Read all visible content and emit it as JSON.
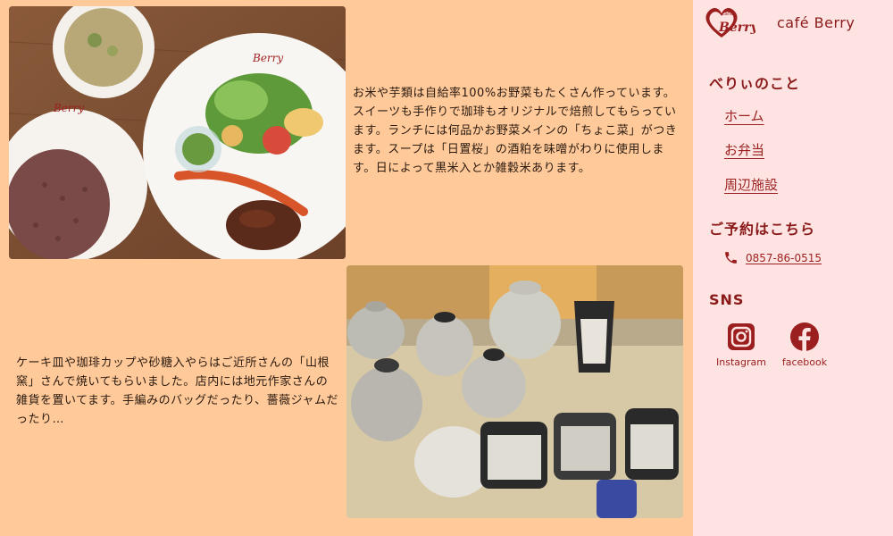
{
  "main": {
    "block1_text": "お米や芋類は自給率100%お野菜もたくさん作っています。スイーツも手作りで珈琲もオリジナルで焙煎してもらっています。ランチには何品かお野菜メインの「ちょこ菜」がつきます。スープは「日置桜」の酒粕を味噌がわりに使用します。日によって黒米入とか雑穀米あります。",
    "block2_text": "ケーキ皿や珈琲カップや砂糖入やらはご近所さんの「山根窯」さんで焼いてもらいました。店内には地元作家さんの雑貨を置いてます。手編みのバッグだったり、薔薇ジャムだったり…",
    "photo1_logo": "Berry",
    "photo1_logo2": "Berry"
  },
  "sidebar": {
    "logo_text": "Berry",
    "logo_small": "cafe",
    "brand_name": "café Berry",
    "about_title": "べりぃのこと",
    "nav": [
      {
        "label": "ホーム"
      },
      {
        "label": "お弁当"
      },
      {
        "label": "周辺施設"
      }
    ],
    "reservation_title": "ご予約はこちら",
    "phone": "0857-86-0515",
    "sns_title": "SNS",
    "instagram_label": "Instagram",
    "facebook_label": "facebook"
  },
  "colors": {
    "main_bg": "#ffc999",
    "sidebar_bg": "#fde4e2",
    "accent": "#8b1a1a"
  }
}
